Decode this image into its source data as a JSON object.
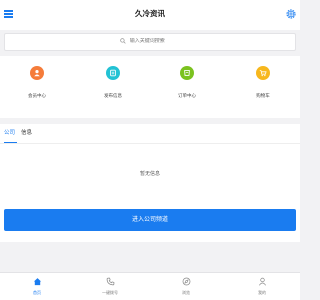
{
  "header": {
    "title": "久冷资讯"
  },
  "search": {
    "placeholder": "输入关键词搜索"
  },
  "colors": {
    "primary": "#1a7cf0",
    "orange": "#f57c3a",
    "cyan": "#22c2d4",
    "green": "#7bc21f",
    "yellow": "#f7b71c"
  },
  "grid": {
    "items": [
      {
        "label": "会员中心",
        "icon": "user-icon"
      },
      {
        "label": "发布信息",
        "icon": "edit-icon"
      },
      {
        "label": "订单中心",
        "icon": "order-icon"
      },
      {
        "label": "购物车",
        "icon": "cart-icon"
      }
    ]
  },
  "tabs": [
    {
      "label": "公司"
    },
    {
      "label": "信息"
    }
  ],
  "content": {
    "empty_text": "暂无信息",
    "enter_button": "进入公司频道"
  },
  "bottom_nav": [
    {
      "label": "首页",
      "icon": "home-icon"
    },
    {
      "label": "一键拨号",
      "icon": "phone-icon"
    },
    {
      "label": "浏览",
      "icon": "browse-icon"
    },
    {
      "label": "我的",
      "icon": "profile-icon"
    }
  ]
}
